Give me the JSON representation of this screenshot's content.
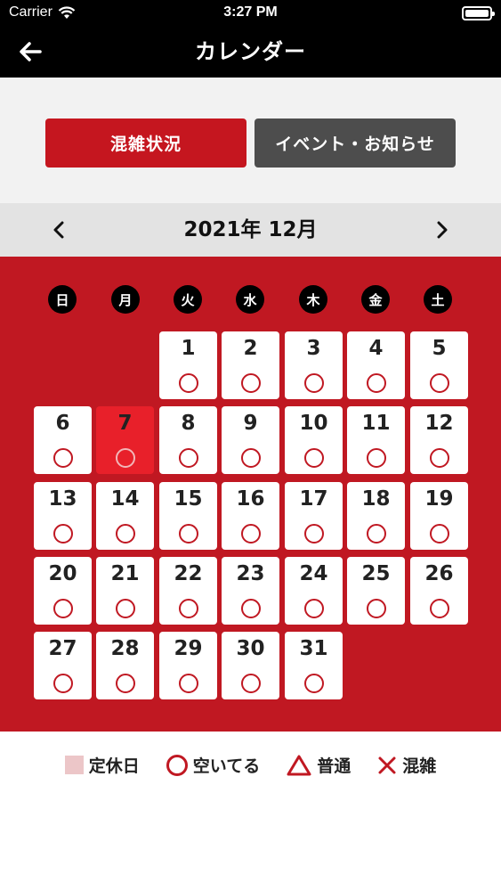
{
  "status_bar": {
    "carrier": "Carrier",
    "time": "3:27 PM"
  },
  "header": {
    "title": "カレンダー"
  },
  "segments": {
    "active_label": "混雑状況",
    "inactive_label": "イベント・お知らせ"
  },
  "calendar": {
    "month_label": "2021年 12月",
    "weekdays": [
      "日",
      "月",
      "火",
      "水",
      "木",
      "金",
      "土"
    ],
    "first_weekday_index": 2,
    "today": 7,
    "days": [
      1,
      2,
      3,
      4,
      5,
      6,
      7,
      8,
      9,
      10,
      11,
      12,
      13,
      14,
      15,
      16,
      17,
      18,
      19,
      20,
      21,
      22,
      23,
      24,
      25,
      26,
      27,
      28,
      29,
      30,
      31
    ],
    "status": "空いてる"
  },
  "legend": {
    "closed": "定休日",
    "empty": "空いてる",
    "normal": "普通",
    "crowded": "混雑"
  },
  "colors": {
    "header_bg": "#000000",
    "accent_red": "#c01822",
    "today_red": "#e8202a",
    "inactive_gray": "#4d4d4d"
  }
}
